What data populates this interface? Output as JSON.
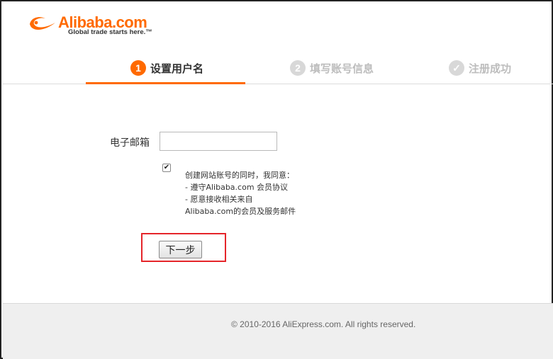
{
  "brand": {
    "name": "Alibaba.com",
    "tagline": "Global trade starts here.™",
    "accent_color": "#ff6a00",
    "logo_icon": "alibaba-smile-icon"
  },
  "steps": [
    {
      "number": "1",
      "label": "设置用户名",
      "state": "active"
    },
    {
      "number": "2",
      "label": "填写账号信息",
      "state": "inactive"
    },
    {
      "number": "✓",
      "label": "注册成功",
      "state": "inactive",
      "icon": "check-circle-icon"
    }
  ],
  "form": {
    "email_label": "电子邮箱",
    "email_value": "",
    "agree_checked": true,
    "agree_lines": [
      "创建网站账号的同时，我同意：",
      "- 遵守Alibaba.com 会员协议",
      "- 愿意接收相关来自",
      "Alibaba.com的会员及服务邮件"
    ],
    "next_label": "下一步",
    "highlight_color": "#e5252a"
  },
  "footer": {
    "copyright": "© 2010-2016 AliExpress.com. All rights reserved."
  }
}
